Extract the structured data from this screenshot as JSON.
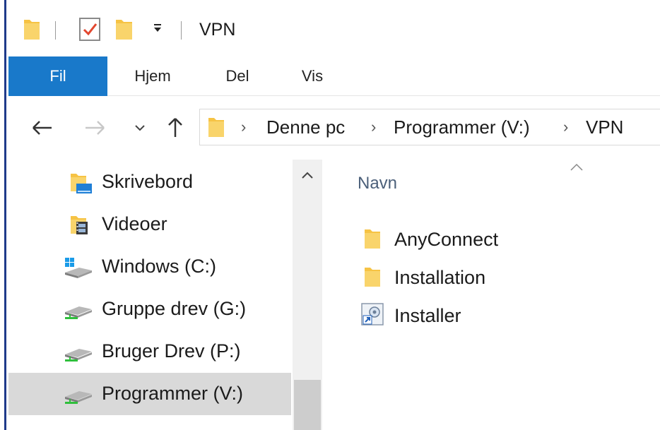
{
  "window": {
    "title": "VPN"
  },
  "ribbon": {
    "tabs": [
      {
        "label": "Fil"
      },
      {
        "label": "Hjem"
      },
      {
        "label": "Del"
      },
      {
        "label": "Vis"
      }
    ]
  },
  "navigation": {
    "breadcrumb": [
      "Denne pc",
      "Programmer (V:)",
      "VPN"
    ]
  },
  "nav_pane": {
    "items": [
      {
        "label": "Skrivebord",
        "icon": "desktop-folder-icon"
      },
      {
        "label": "Videoer",
        "icon": "videos-folder-icon"
      },
      {
        "label": "Windows (C:)",
        "icon": "windows-drive-icon"
      },
      {
        "label": "Gruppe drev (G:)",
        "icon": "network-drive-icon"
      },
      {
        "label": "Bruger Drev (P:)",
        "icon": "network-drive-icon"
      },
      {
        "label": "Programmer (V:)",
        "icon": "network-drive-icon",
        "selected": true
      }
    ]
  },
  "content": {
    "column_header": "Navn",
    "files": [
      {
        "name": "AnyConnect",
        "icon": "folder-icon"
      },
      {
        "name": "Installation",
        "icon": "folder-icon"
      },
      {
        "name": "Installer",
        "icon": "installer-shortcut-icon"
      }
    ]
  },
  "colors": {
    "accent": "#1979ca",
    "folder": "#f6c344",
    "selection": "#d9d9d9"
  }
}
